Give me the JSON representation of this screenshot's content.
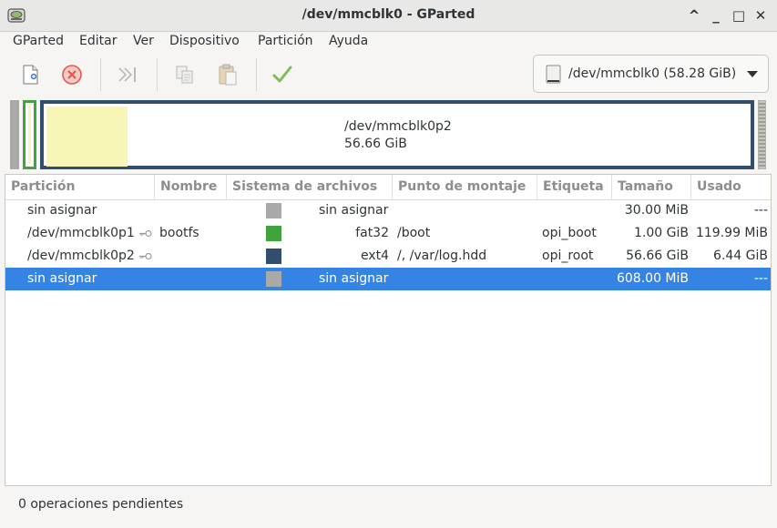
{
  "window": {
    "title": "/dev/mmcblk0 - GParted",
    "buttons": [
      "^",
      "_",
      "□",
      "✕"
    ]
  },
  "menu": [
    "GParted",
    "Editar",
    "Ver",
    "Dispositivo",
    "Partición",
    "Ayuda"
  ],
  "toolbar": {
    "buttons": [
      "new-icon",
      "delete-icon",
      "resize-move-icon",
      "copy-icon",
      "paste-icon",
      "apply-icon"
    ]
  },
  "device": {
    "label": "/dev/mmcblk0 (58.28 GiB)"
  },
  "diskmap": {
    "name": "/dev/mmcblk0p2",
    "size": "56.66 GiB"
  },
  "table": {
    "headers": [
      "Partición",
      "Nombre",
      "Sistema de archivos",
      "Punto de montaje",
      "Etiqueta",
      "Tamaño",
      "Usado"
    ],
    "rows": [
      {
        "partition": "sin asignar",
        "name": "",
        "fs_color": "#a9a9a9",
        "filesystem": "sin asignar",
        "mount": "",
        "label": "",
        "size": "30.00 MiB",
        "used": "---",
        "key": false,
        "selected": false
      },
      {
        "partition": "/dev/mmcblk0p1",
        "name": "bootfs",
        "fs_color": "#41a33e",
        "filesystem": "fat32",
        "mount": "/boot",
        "label": "opi_boot",
        "size": "1.00 GiB",
        "used": "119.99 MiB",
        "key": true,
        "selected": false
      },
      {
        "partition": "/dev/mmcblk0p2",
        "name": "",
        "fs_color": "#314e6c",
        "filesystem": "ext4",
        "mount": "/, /var/log.hdd",
        "label": "opi_root",
        "size": "56.66 GiB",
        "used": "6.44 GiB",
        "key": true,
        "selected": false
      },
      {
        "partition": "sin asignar",
        "name": "",
        "fs_color": "#a9a9a9",
        "filesystem": "sin asignar",
        "mount": "",
        "label": "",
        "size": "608.00 MiB",
        "used": "---",
        "key": false,
        "selected": true
      }
    ]
  },
  "status": "0 operaciones pendientes",
  "colors": {
    "selection": "#3584e4",
    "fat32": "#41a33e",
    "ext4": "#314e6c",
    "unallocated": "#a9a9a9",
    "used_fill": "#f8f6b6"
  }
}
